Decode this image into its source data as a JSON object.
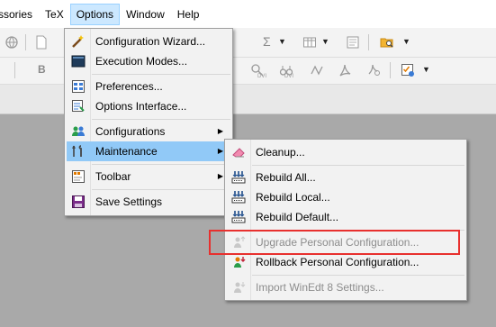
{
  "menubar": {
    "items": [
      {
        "label": "ssories"
      },
      {
        "label": "TeX"
      },
      {
        "label": "Options"
      },
      {
        "label": "Window"
      },
      {
        "label": "Help"
      }
    ]
  },
  "options_menu": {
    "items": [
      {
        "label": "Configuration Wizard...",
        "icon": "wand-icon"
      },
      {
        "label": "Execution Modes...",
        "icon": "terminal-icon"
      },
      {
        "label": "Preferences...",
        "icon": "preferences-icon"
      },
      {
        "label": "Options Interface...",
        "icon": "options-interface-icon"
      },
      {
        "label": "Configurations",
        "icon": "users-icon",
        "submenu": true
      },
      {
        "label": "Maintenance",
        "icon": "tools-icon",
        "submenu": true,
        "highlighted": true
      },
      {
        "label": "Toolbar",
        "icon": "toolbar-icon",
        "submenu": true
      },
      {
        "label": "Save Settings",
        "icon": "save-icon"
      }
    ]
  },
  "maintenance_menu": {
    "items": [
      {
        "label": "Cleanup...",
        "icon": "eraser-icon",
        "enabled": true
      },
      {
        "label": "Rebuild All...",
        "icon": "rebuild-icon",
        "enabled": true
      },
      {
        "label": "Rebuild Local...",
        "icon": "rebuild-icon",
        "enabled": true
      },
      {
        "label": "Rebuild Default...",
        "icon": "rebuild-icon",
        "enabled": true
      },
      {
        "label": "Upgrade Personal Configuration...",
        "icon": "upgrade-icon",
        "enabled": false
      },
      {
        "label": "Rollback Personal Configuration...",
        "icon": "rollback-icon",
        "enabled": true
      },
      {
        "label": "Import WinEdt 8 Settings...",
        "icon": "import-icon",
        "enabled": false
      }
    ]
  },
  "toolbar": {
    "bold_label": "B",
    "sigma_label": "Σ",
    "dvi_label": "DVI"
  },
  "colors": {
    "highlight": "#91c9f7",
    "annotation": "#e8302e",
    "menubar_active": "#cce8ff"
  }
}
